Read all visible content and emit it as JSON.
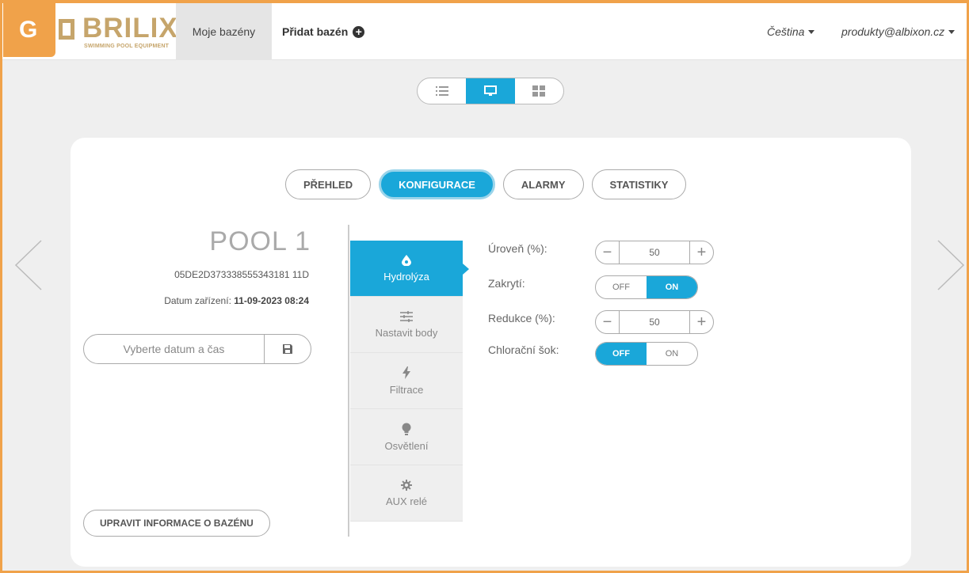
{
  "brand": {
    "badge": "G",
    "logo_text": "BRILIX",
    "logo_sub": "SWIMMING POOL EQUIPMENT"
  },
  "nav": {
    "my_pools": "Moje bazény",
    "add_pool": "Přidat bazén",
    "language": "Čeština",
    "user": "produkty@albixon.cz"
  },
  "view_toggle": {
    "options": [
      "list-icon",
      "monitor-icon",
      "grid-icon"
    ],
    "active": "monitor-icon"
  },
  "tabs": [
    {
      "label": "PŘEHLED",
      "active": false
    },
    {
      "label": "KONFIGURACE",
      "active": true
    },
    {
      "label": "ALARMY",
      "active": false
    },
    {
      "label": "STATISTIKY",
      "active": false
    }
  ],
  "pool": {
    "name": "POOL 1",
    "id": "05DE2D373338555343181 11D",
    "date_label": "Datum zařízení:",
    "date_value": "11-09-2023 08:24",
    "date_placeholder": "Vyberte datum a čas",
    "edit_button": "UPRAVIT INFORMACE O BAZÉNU"
  },
  "menu": [
    {
      "label": "Hydrolýza",
      "icon": "drop-icon",
      "active": true
    },
    {
      "label": "Nastavit body",
      "icon": "sliders-icon",
      "active": false
    },
    {
      "label": "Filtrace",
      "icon": "bolt-icon",
      "active": false
    },
    {
      "label": "Osvětlení",
      "icon": "bulb-icon",
      "active": false
    },
    {
      "label": "AUX relé",
      "icon": "gear-icon",
      "active": false
    }
  ],
  "settings": {
    "level_label": "Úroveň (%):",
    "level_value": "50",
    "cover_label": "Zakrytí:",
    "cover_off": "OFF",
    "cover_on": "ON",
    "cover_state": "ON",
    "reduction_label": "Redukce (%):",
    "reduction_value": "50",
    "shock_label": "Chlorační šok:",
    "shock_off": "OFF",
    "shock_on": "ON",
    "shock_state": "OFF"
  },
  "colors": {
    "accent": "#1aa7d9",
    "brand": "#c6a56b",
    "frame": "#f0a24a"
  }
}
